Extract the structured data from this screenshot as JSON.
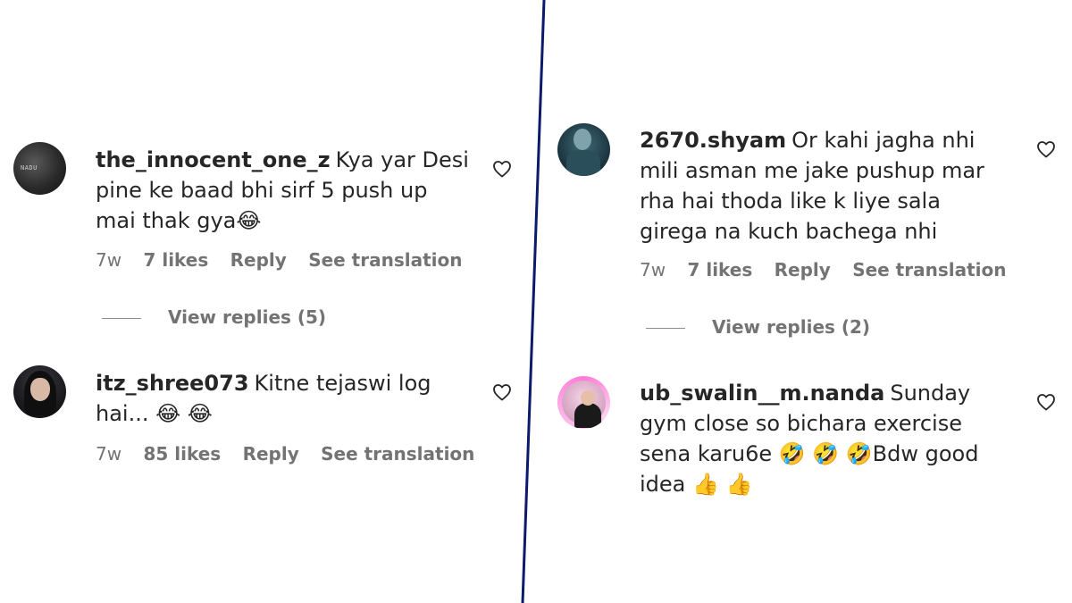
{
  "comments": [
    {
      "username": "the_innocent_one_z",
      "text": "Kya yar Desi pine ke baad bhi sirf 5 push up mai thak gya😂",
      "time": "7w",
      "likes": "7 likes",
      "reply": "Reply",
      "translate": "See translation",
      "view_replies": "View replies (5)",
      "avatar_tag": "NADU"
    },
    {
      "username": "itz_shree073",
      "text": "Kitne tejaswi log hai... 😂 😂",
      "time": "7w",
      "likes": "85 likes",
      "reply": "Reply",
      "translate": "See translation"
    },
    {
      "username": "2670.shyam",
      "text": "Or kahi jagha nhi mili asman me jake pushup mar rha hai thoda like k liye sala girega na kuch bachega nhi",
      "time": "7w",
      "likes": "7 likes",
      "reply": "Reply",
      "translate": "See translation",
      "view_replies": "View replies (2)"
    },
    {
      "username": "ub_swalin__m.nanda",
      "text": "Sunday gym close so bichara exercise sena karu6e 🤣 🤣 🤣Bdw good idea 👍 👍"
    }
  ],
  "colors": {
    "text": "#262626",
    "meta": "#737373",
    "divider": "#0b1a6b"
  },
  "icons": [
    "heart-icon"
  ]
}
